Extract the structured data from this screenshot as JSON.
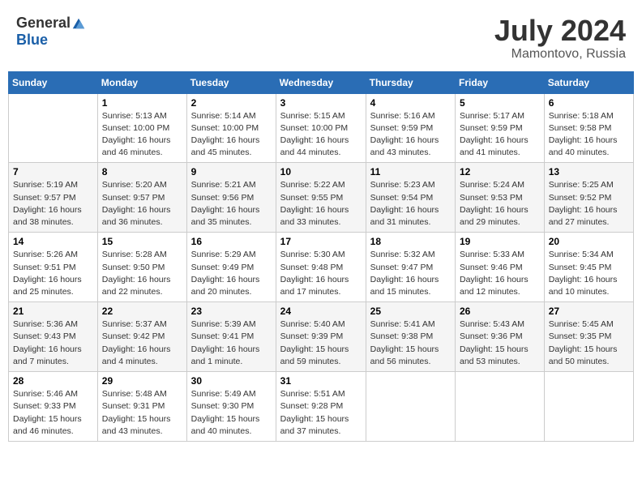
{
  "header": {
    "logo_general": "General",
    "logo_blue": "Blue",
    "month_title": "July 2024",
    "location": "Mamontovo, Russia"
  },
  "weekdays": [
    "Sunday",
    "Monday",
    "Tuesday",
    "Wednesday",
    "Thursday",
    "Friday",
    "Saturday"
  ],
  "weeks": [
    [
      {
        "day": null,
        "info": null
      },
      {
        "day": "1",
        "info": "Sunrise: 5:13 AM\nSunset: 10:00 PM\nDaylight: 16 hours\nand 46 minutes."
      },
      {
        "day": "2",
        "info": "Sunrise: 5:14 AM\nSunset: 10:00 PM\nDaylight: 16 hours\nand 45 minutes."
      },
      {
        "day": "3",
        "info": "Sunrise: 5:15 AM\nSunset: 10:00 PM\nDaylight: 16 hours\nand 44 minutes."
      },
      {
        "day": "4",
        "info": "Sunrise: 5:16 AM\nSunset: 9:59 PM\nDaylight: 16 hours\nand 43 minutes."
      },
      {
        "day": "5",
        "info": "Sunrise: 5:17 AM\nSunset: 9:59 PM\nDaylight: 16 hours\nand 41 minutes."
      },
      {
        "day": "6",
        "info": "Sunrise: 5:18 AM\nSunset: 9:58 PM\nDaylight: 16 hours\nand 40 minutes."
      }
    ],
    [
      {
        "day": "7",
        "info": "Sunrise: 5:19 AM\nSunset: 9:57 PM\nDaylight: 16 hours\nand 38 minutes."
      },
      {
        "day": "8",
        "info": "Sunrise: 5:20 AM\nSunset: 9:57 PM\nDaylight: 16 hours\nand 36 minutes."
      },
      {
        "day": "9",
        "info": "Sunrise: 5:21 AM\nSunset: 9:56 PM\nDaylight: 16 hours\nand 35 minutes."
      },
      {
        "day": "10",
        "info": "Sunrise: 5:22 AM\nSunset: 9:55 PM\nDaylight: 16 hours\nand 33 minutes."
      },
      {
        "day": "11",
        "info": "Sunrise: 5:23 AM\nSunset: 9:54 PM\nDaylight: 16 hours\nand 31 minutes."
      },
      {
        "day": "12",
        "info": "Sunrise: 5:24 AM\nSunset: 9:53 PM\nDaylight: 16 hours\nand 29 minutes."
      },
      {
        "day": "13",
        "info": "Sunrise: 5:25 AM\nSunset: 9:52 PM\nDaylight: 16 hours\nand 27 minutes."
      }
    ],
    [
      {
        "day": "14",
        "info": "Sunrise: 5:26 AM\nSunset: 9:51 PM\nDaylight: 16 hours\nand 25 minutes."
      },
      {
        "day": "15",
        "info": "Sunrise: 5:28 AM\nSunset: 9:50 PM\nDaylight: 16 hours\nand 22 minutes."
      },
      {
        "day": "16",
        "info": "Sunrise: 5:29 AM\nSunset: 9:49 PM\nDaylight: 16 hours\nand 20 minutes."
      },
      {
        "day": "17",
        "info": "Sunrise: 5:30 AM\nSunset: 9:48 PM\nDaylight: 16 hours\nand 17 minutes."
      },
      {
        "day": "18",
        "info": "Sunrise: 5:32 AM\nSunset: 9:47 PM\nDaylight: 16 hours\nand 15 minutes."
      },
      {
        "day": "19",
        "info": "Sunrise: 5:33 AM\nSunset: 9:46 PM\nDaylight: 16 hours\nand 12 minutes."
      },
      {
        "day": "20",
        "info": "Sunrise: 5:34 AM\nSunset: 9:45 PM\nDaylight: 16 hours\nand 10 minutes."
      }
    ],
    [
      {
        "day": "21",
        "info": "Sunrise: 5:36 AM\nSunset: 9:43 PM\nDaylight: 16 hours\nand 7 minutes."
      },
      {
        "day": "22",
        "info": "Sunrise: 5:37 AM\nSunset: 9:42 PM\nDaylight: 16 hours\nand 4 minutes."
      },
      {
        "day": "23",
        "info": "Sunrise: 5:39 AM\nSunset: 9:41 PM\nDaylight: 16 hours\nand 1 minute."
      },
      {
        "day": "24",
        "info": "Sunrise: 5:40 AM\nSunset: 9:39 PM\nDaylight: 15 hours\nand 59 minutes."
      },
      {
        "day": "25",
        "info": "Sunrise: 5:41 AM\nSunset: 9:38 PM\nDaylight: 15 hours\nand 56 minutes."
      },
      {
        "day": "26",
        "info": "Sunrise: 5:43 AM\nSunset: 9:36 PM\nDaylight: 15 hours\nand 53 minutes."
      },
      {
        "day": "27",
        "info": "Sunrise: 5:45 AM\nSunset: 9:35 PM\nDaylight: 15 hours\nand 50 minutes."
      }
    ],
    [
      {
        "day": "28",
        "info": "Sunrise: 5:46 AM\nSunset: 9:33 PM\nDaylight: 15 hours\nand 46 minutes."
      },
      {
        "day": "29",
        "info": "Sunrise: 5:48 AM\nSunset: 9:31 PM\nDaylight: 15 hours\nand 43 minutes."
      },
      {
        "day": "30",
        "info": "Sunrise: 5:49 AM\nSunset: 9:30 PM\nDaylight: 15 hours\nand 40 minutes."
      },
      {
        "day": "31",
        "info": "Sunrise: 5:51 AM\nSunset: 9:28 PM\nDaylight: 15 hours\nand 37 minutes."
      },
      {
        "day": null,
        "info": null
      },
      {
        "day": null,
        "info": null
      },
      {
        "day": null,
        "info": null
      }
    ]
  ]
}
